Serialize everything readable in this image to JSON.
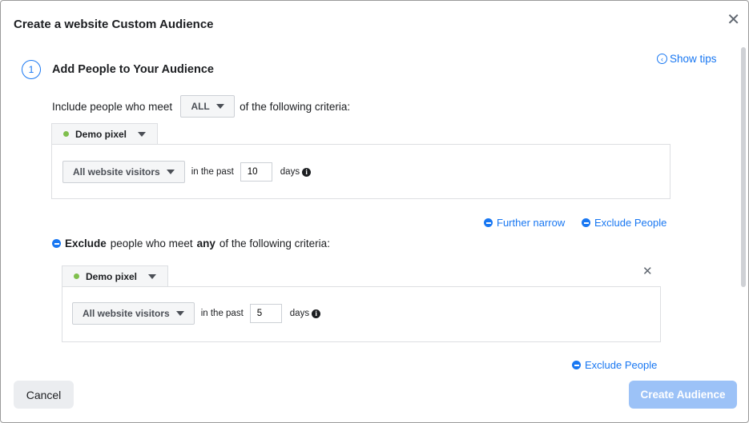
{
  "dialog": {
    "title": "Create a website Custom Audience",
    "close_icon": "close-icon"
  },
  "step": {
    "number": "1",
    "title": "Add People to Your Audience",
    "show_tips": "Show tips"
  },
  "include": {
    "prefix": "Include people who meet",
    "match_value": "ALL",
    "suffix": "of the following criteria:",
    "pixel": "Demo pixel",
    "event": "All website visitors",
    "in_the_past": "in the past",
    "days_value": "10",
    "days_label": "days"
  },
  "links": {
    "further_narrow": "Further narrow",
    "exclude_people": "Exclude People",
    "exclude_people_bottom": "Exclude People"
  },
  "exclude": {
    "label_bold": "Exclude",
    "middle": "people who meet",
    "any": "any",
    "suffix": "of the following criteria:",
    "pixel": "Demo pixel",
    "event": "All website visitors",
    "in_the_past": "in the past",
    "days_value": "5",
    "days_label": "days"
  },
  "footer": {
    "cancel": "Cancel",
    "create": "Create Audience"
  },
  "colors": {
    "accent": "#1877f2",
    "pixel_status": "#7fbf4d",
    "disabled_primary": "#9cc2f7"
  }
}
